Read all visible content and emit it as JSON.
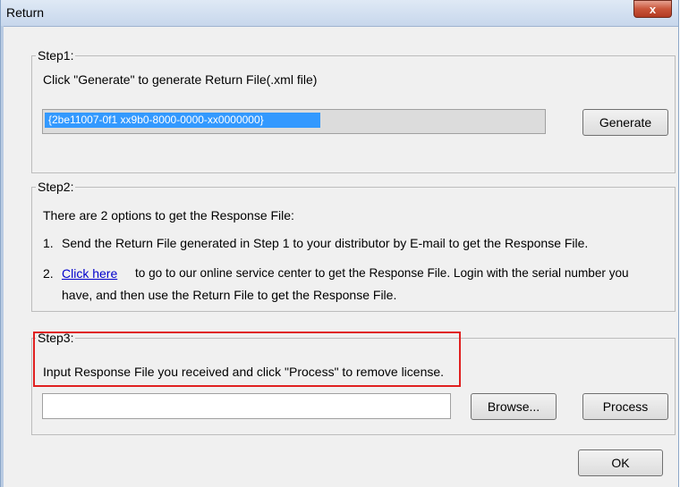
{
  "window": {
    "title": "Return",
    "close_glyph": "x"
  },
  "step1": {
    "legend": "Step1:",
    "instruction": "Click \"Generate\" to generate Return File(.xml file)",
    "return_file_value": "{2be11007-0f1 xx9b0-8000-0000-xx0000000}",
    "generate_label": "Generate"
  },
  "step2": {
    "legend": "Step2:",
    "intro": "There are 2 options to get the Response File:",
    "option1_number": "1.",
    "option1_text": "Send the Return File generated in Step 1 to your distributor by E-mail to get the Response File.",
    "option2_number": "2.",
    "option2_link": "Click here",
    "option2_text_line1": "to go to our online service center to get the Response File. Login with the serial number you",
    "option2_text_line2": "have, and then use the Return File to get the Response File."
  },
  "step3": {
    "legend": "Step3:",
    "instruction": "Input Response File you received and click \"Process\" to remove license.",
    "response_file_value": "",
    "browse_label": "Browse...",
    "process_label": "Process"
  },
  "footer": {
    "ok_label": "OK"
  },
  "colors": {
    "highlight": "#e02020",
    "link": "#0000cc",
    "selection": "#3399ff"
  }
}
